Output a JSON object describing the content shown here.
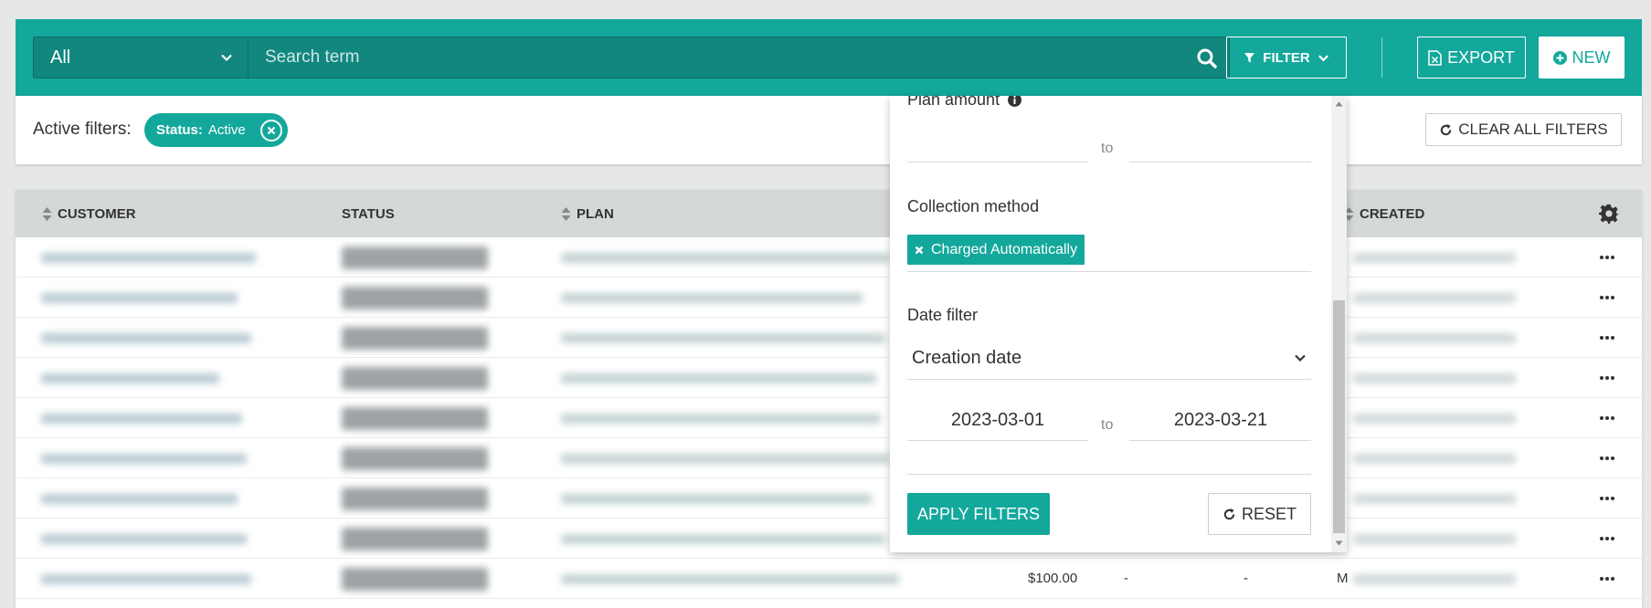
{
  "toolbar": {
    "scope_value": "All",
    "search_placeholder": "Search term",
    "filter_label": "FILTER",
    "export_label": "EXPORT",
    "new_label": "NEW"
  },
  "active_filters": {
    "label": "Active filters:",
    "chips": [
      {
        "key": "Status:",
        "value": "Active"
      }
    ],
    "clear_all_label": "CLEAR ALL FILTERS"
  },
  "table": {
    "columns": [
      "CUSTOMER",
      "STATUS",
      "PLAN",
      "CREATED"
    ],
    "visible_last_row": {
      "amount": "$100.00",
      "col_a": "-",
      "col_b": "-",
      "created_partial": "M"
    }
  },
  "filter_panel": {
    "plan_amount_label": "Plan amount",
    "to_label": "to",
    "collection_method_label": "Collection method",
    "collection_method_tag": "Charged Automatically",
    "date_filter_label": "Date filter",
    "date_filter_selected": "Creation date",
    "date_from": "2023-03-01",
    "date_to": "2023-03-21",
    "apply_label": "APPLY FILTERS",
    "reset_label": "RESET"
  },
  "colors": {
    "brand": "#13a89b",
    "brand_dark": "#11877e"
  }
}
